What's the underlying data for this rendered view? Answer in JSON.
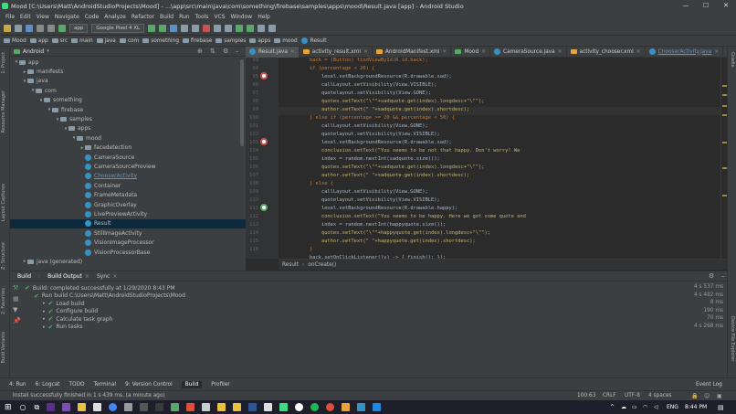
{
  "window": {
    "title": "Mood [C:\\Users\\Matt\\AndroidStudioProjects\\Mood] - ...\\app\\src\\main\\java\\com\\something\\firebase\\samples\\apps\\mood\\Result.java [app] - Android Studio",
    "controls": [
      "—",
      "☐",
      "✕"
    ]
  },
  "menu": [
    "File",
    "Edit",
    "View",
    "Navigate",
    "Code",
    "Analyze",
    "Refactor",
    "Build",
    "Run",
    "Tools",
    "VCS",
    "Window",
    "Help"
  ],
  "toolbar": {
    "config": "app",
    "device": "Google Pixel 4 XL"
  },
  "nav": [
    "Mood",
    "app",
    "src",
    "main",
    "java",
    "com",
    "something",
    "firebase",
    "samples",
    "apps",
    "mood",
    "Result"
  ],
  "project": {
    "view_label": "Android",
    "tree": [
      {
        "label": "app",
        "indent": 0,
        "arrow": "▾",
        "icon": "folder"
      },
      {
        "label": "manifests",
        "indent": 1,
        "arrow": "▸",
        "icon": "folder"
      },
      {
        "label": "java",
        "indent": 1,
        "arrow": "▾",
        "icon": "folder"
      },
      {
        "label": "com",
        "indent": 2,
        "arrow": "▾",
        "icon": "folder"
      },
      {
        "label": "something",
        "indent": 3,
        "arrow": "▾",
        "icon": "folder"
      },
      {
        "label": "firebase",
        "indent": 4,
        "arrow": "▾",
        "icon": "folder"
      },
      {
        "label": "samples",
        "indent": 5,
        "arrow": "▾",
        "icon": "folder"
      },
      {
        "label": "apps",
        "indent": 6,
        "arrow": "▾",
        "icon": "folder"
      },
      {
        "label": "mood",
        "indent": 7,
        "arrow": "▾",
        "icon": "folder"
      },
      {
        "label": "facedetection",
        "indent": 8,
        "arrow": "▸",
        "icon": "folder"
      },
      {
        "label": "CameraSource",
        "indent": 8,
        "arrow": "",
        "icon": "class"
      },
      {
        "label": "CameraSourcePreview",
        "indent": 8,
        "arrow": "",
        "icon": "class"
      },
      {
        "label": "ChooserActivity",
        "indent": 8,
        "arrow": "",
        "icon": "class"
      },
      {
        "label": "Container",
        "indent": 8,
        "arrow": "",
        "icon": "class"
      },
      {
        "label": "FrameMetadata",
        "indent": 8,
        "arrow": "",
        "icon": "class"
      },
      {
        "label": "GraphicOverlay",
        "indent": 8,
        "arrow": "",
        "icon": "class"
      },
      {
        "label": "LivePreviewActivity",
        "indent": 8,
        "arrow": "",
        "icon": "class"
      },
      {
        "label": "Result",
        "indent": 8,
        "arrow": "",
        "icon": "class",
        "selected": true
      },
      {
        "label": "StillImageActivity",
        "indent": 8,
        "arrow": "",
        "icon": "class"
      },
      {
        "label": "VisionImageProcessor",
        "indent": 8,
        "arrow": "",
        "icon": "class"
      },
      {
        "label": "VisionProcessorBase",
        "indent": 8,
        "arrow": "",
        "icon": "class"
      },
      {
        "label": "java (generated)",
        "indent": 1,
        "arrow": "▸",
        "icon": "folder"
      }
    ]
  },
  "tabs": [
    "Result.java",
    "activity_result.xml",
    "AndroidManifest.xml",
    "Mood",
    "CameraSource.java",
    "activity_chooser.xml",
    "ChooserActivity.java"
  ],
  "lines": [
    "93",
    "94",
    "95",
    "96",
    "97",
    "98",
    "99",
    "100",
    "101",
    "102",
    "103",
    "104",
    "105",
    "106",
    "107",
    "108",
    "109",
    "110",
    "111",
    "112",
    "113",
    "114",
    "115",
    "116"
  ],
  "code": [
    "        back = (Button) findViewById(R.id.back);",
    "        if (percentage < 20) {",
    "            level.setBackgroundResource(R.drawable.sad);",
    "            callLayout.setVisibility(View.VISIBLE);",
    "            quotelayout.setVisibility(View.GONE);",
    "            quotes.setText(\"\\\"\"+sadquote.get(index).longdesc+\"\\\"\");",
    "            author.setText(\" \"+sadquote.get(index).shortdesc);",
    "        } else if (percentage >= 20 && percentage < 50) {",
    "            callLayout.setVisibility(View.GONE);",
    "            quotelayout.setVisibility(View.VISIBLE);",
    "            level.setBackgroundResource(R.drawable.sad);",
    "            conclusion.setText(\"You seems to be not that happy. Don't worry! We",
    "            index = random.nextInt(sadquote.size());",
    "            quotes.setText(\"\\\"\"+sadquote.get(index).longdesc+\"\\\"\");",
    "            author.setText(\" \"+sadquote.get(index).shortdesc);",
    "        } else {",
    "            callLayout.setVisibility(View.GONE);",
    "            quotelayout.setVisibility(View.VISIBLE);",
    "            level.setBackgroundResource(R.drawable.happy);",
    "            conclusion.setText(\"You seems to be happy. Here we got some quote and",
    "            index = random.nextInt(happyquote.size());",
    "            quotes.setText(\"\\\"\"+happyquote.get(index).longdesc+\"\\\"\");",
    "            author.setText(\" \"+happyquote.get(index).shortdesc);",
    "        }"
  ],
  "code_tail": "        back.setOnClickListener((v) -> { finish(); });",
  "editor_crumb": [
    "Result",
    "onCreate()"
  ],
  "build": {
    "tabs": [
      "Build",
      "Build Output",
      "Sync"
    ],
    "rows": [
      {
        "text": "Build: completed successfully at 1/29/2020 8:43 PM",
        "time": "4 s 537 ms",
        "indent": 0
      },
      {
        "text": "Run build C:\\Users\\Matt\\AndroidStudioProjects\\Mood",
        "time": "4 s 482 ms",
        "indent": 1
      },
      {
        "text": "Load build",
        "time": "8 ms",
        "indent": 2
      },
      {
        "text": "Configure build",
        "time": "190 ms",
        "indent": 2
      },
      {
        "text": "Calculate task graph",
        "time": "70 ms",
        "indent": 2
      },
      {
        "text": "Run tasks",
        "time": "4 s 268 ms",
        "indent": 2
      }
    ]
  },
  "left_strip": [
    "1: Project",
    "Resource Manager",
    "Layout Captures",
    "Z: Structure",
    "2: Favorites",
    "Build Variants"
  ],
  "right_strip": [
    "Gradle",
    "Device File Explorer"
  ],
  "bottom_tools": [
    "4: Run",
    "6: Logcat",
    "TODO",
    "Terminal",
    "9: Version Control",
    "Build",
    "Profiler"
  ],
  "event_log": "Event Log",
  "status": {
    "message": "Install successfully finished in 1 s 439 ms. (a minute ago)",
    "pos": "100:63",
    "eol": "CRLF",
    "enc": "UTF-8",
    "indent": "4 spaces"
  },
  "taskbar": {
    "lang": "ENG",
    "time": "8:44 PM"
  }
}
